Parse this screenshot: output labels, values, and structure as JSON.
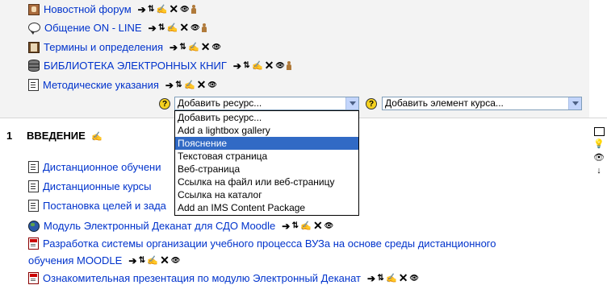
{
  "activities_top": [
    {
      "title": "Новостной форум",
      "icon": "forum-icon",
      "has_groups": true
    },
    {
      "title": "Общение ON - LINE",
      "icon": "chat-icon",
      "has_groups": true
    },
    {
      "title": "Термины и определения",
      "icon": "glossary-icon",
      "has_groups": false
    },
    {
      "title": "БИБЛИОТЕКА ЭЛЕКТРОННЫХ КНИГ",
      "icon": "database-icon",
      "has_groups": true
    },
    {
      "title": "Методические указания",
      "icon": "document-icon",
      "has_groups": false
    }
  ],
  "add_resource": {
    "help": "?",
    "selected": "Добавить ресурс..."
  },
  "add_activity": {
    "help": "?",
    "selected": "Добавить элемент курса..."
  },
  "resource_dropdown": {
    "options": [
      "Добавить ресурс...",
      "Add a lightbox gallery",
      "Пояснение",
      "Текстовая страница",
      "Веб-страница",
      "Ссылка на файл или веб-страницу",
      "Ссылка на каталог",
      "Add an IMS Content Package"
    ],
    "highlighted_index": 2
  },
  "section1": {
    "number": "1",
    "title": "ВВЕДЕНИЕ",
    "activities": [
      {
        "title": "Дистанционное обучени",
        "icon": "document-icon"
      },
      {
        "title": "Дистанционные курсы",
        "icon": "document-icon"
      },
      {
        "title": "Постановка целей и зада",
        "icon": "document-icon"
      },
      {
        "title": "Модуль Электронный Деканат для СДО Moodle",
        "icon": "globe-icon"
      },
      {
        "title": "Разработка системы организации учебного процесса ВУЗа на основе среды дистанционного",
        "title_line2": "обучения MOODLE",
        "icon": "pdf-icon"
      },
      {
        "title": "Ознакомительная презентация по модулю Электронный Деканат",
        "icon": "pdf-icon"
      }
    ]
  },
  "action_glyphs": {
    "move": "➔",
    "update": "⇅",
    "edit": "✍",
    "delete": "✕",
    "hide": "👁"
  },
  "colors": {
    "link": "#0033cc",
    "section_bg": "#f3f3f3",
    "highlight": "#316ac5"
  }
}
